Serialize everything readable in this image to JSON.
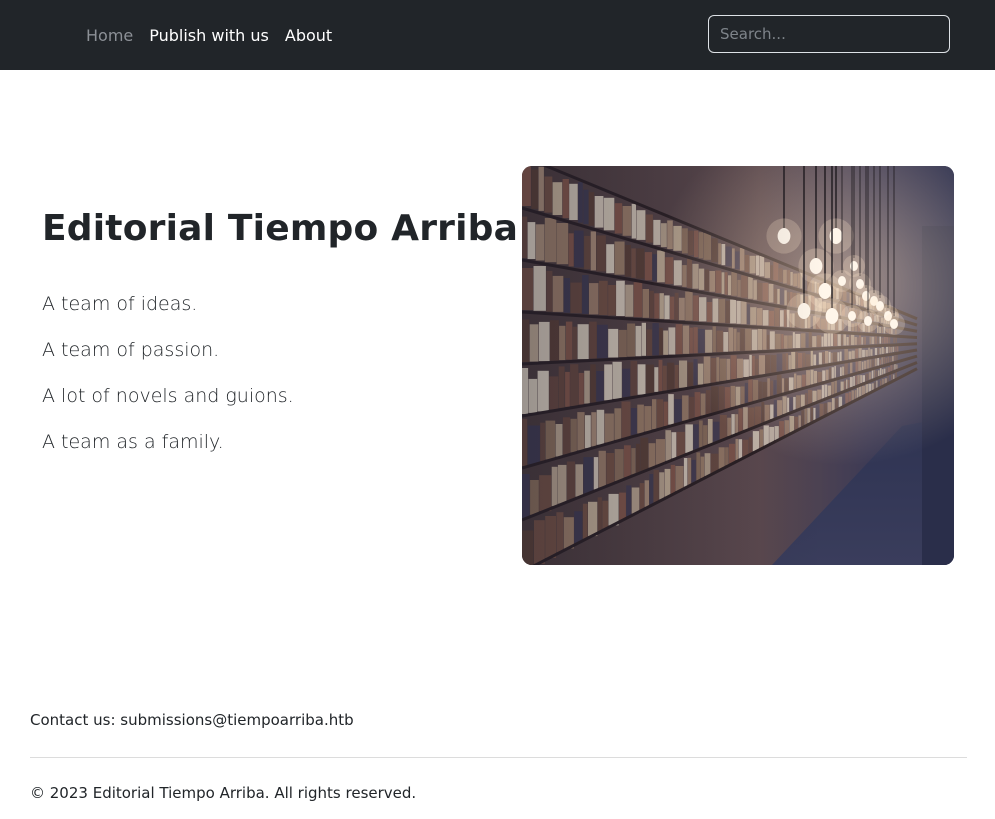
{
  "nav": {
    "links": [
      {
        "label": "Home",
        "active": true
      },
      {
        "label": "Publish with us",
        "active": false
      },
      {
        "label": "About",
        "active": false
      }
    ],
    "search_placeholder": "Search..."
  },
  "hero": {
    "title": "Editorial Tiempo Arriba",
    "taglines": [
      "A team of ideas.",
      "A team of passion.",
      "A lot of novels and guions.",
      "A team as a family."
    ]
  },
  "footer": {
    "contact_label": "Contact us:",
    "contact_email": "submissions@tiempoarriba.htb",
    "copyright": "© 2023 Editorial Tiempo Arriba. All rights reserved."
  },
  "colors": {
    "navbar_bg": "#212529",
    "nav_active": "#8c9096",
    "nav_text": "#ffffff",
    "body_text": "#212529"
  }
}
